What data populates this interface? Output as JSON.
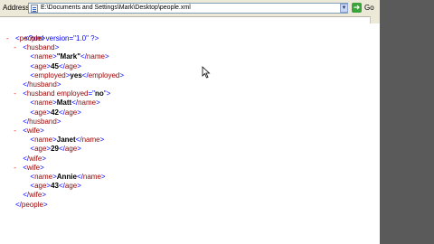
{
  "address_bar": {
    "label": "Address",
    "url": "E:\\Documents and Settings\\Mark\\Desktop\\people.xml",
    "go_label": "Go"
  },
  "xml_view": {
    "declaration": "<?xml version=\"1.0\" ?>",
    "lines": [
      {
        "indent": 0,
        "collapse": "-",
        "text": "<people>"
      },
      {
        "indent": 1,
        "collapse": "-",
        "text": "<husband>"
      },
      {
        "indent": 2,
        "collapse": "",
        "open": "<name>",
        "value": "\"Mark\"",
        "close": "</name>"
      },
      {
        "indent": 2,
        "collapse": "",
        "open": "<age>",
        "value": "45",
        "close": "</age>"
      },
      {
        "indent": 2,
        "collapse": "",
        "open": "<employed>",
        "value": "yes",
        "close": "</employed>"
      },
      {
        "indent": 1,
        "collapse": "",
        "text": "</husband>"
      },
      {
        "indent": 1,
        "collapse": "-",
        "text_open": "<husband employed=\"",
        "attr": "no",
        "text_close": "\">"
      },
      {
        "indent": 2,
        "collapse": "",
        "open": "<name>",
        "value": "Matt",
        "close": "</name>"
      },
      {
        "indent": 2,
        "collapse": "",
        "open": "<age>",
        "value": "42",
        "close": "</age>"
      },
      {
        "indent": 1,
        "collapse": "",
        "text": "</husband>"
      },
      {
        "indent": 1,
        "collapse": "-",
        "text": "<wife>"
      },
      {
        "indent": 2,
        "collapse": "",
        "open": "<name>",
        "value": "Janet",
        "close": "</name>"
      },
      {
        "indent": 2,
        "collapse": "",
        "open": "<age>",
        "value": "29",
        "close": "</age>"
      },
      {
        "indent": 1,
        "collapse": "",
        "text": "</wife>"
      },
      {
        "indent": 1,
        "collapse": "-",
        "text": "<wife>"
      },
      {
        "indent": 2,
        "collapse": "",
        "open": "<name>",
        "value": "Annie",
        "close": "</name>"
      },
      {
        "indent": 2,
        "collapse": "",
        "open": "<age>",
        "value": "43",
        "close": "</age>"
      },
      {
        "indent": 1,
        "collapse": "",
        "text": "</wife>"
      },
      {
        "indent": 0,
        "collapse": "",
        "text": "</people>"
      }
    ]
  },
  "colors": {
    "collapse_marker": "#ff0000",
    "tag_name": "#990000",
    "bracket": "#0000ff",
    "side_strip": "#5a5a5a"
  }
}
